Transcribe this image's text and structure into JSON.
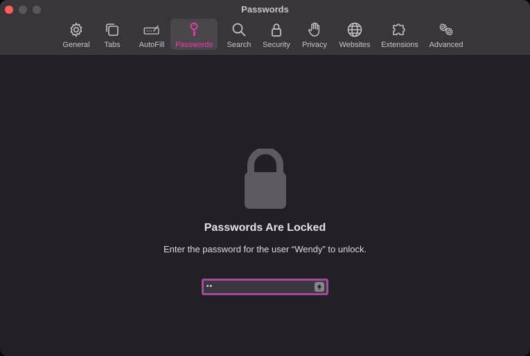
{
  "window": {
    "title": "Passwords"
  },
  "toolbar": {
    "items": [
      {
        "label": "General",
        "icon": "gear-icon",
        "active": false
      },
      {
        "label": "Tabs",
        "icon": "tabs-icon",
        "active": false
      },
      {
        "label": "AutoFill",
        "icon": "autofill-icon",
        "active": false
      },
      {
        "label": "Passwords",
        "icon": "key-icon",
        "active": true
      },
      {
        "label": "Search",
        "icon": "magnifier-icon",
        "active": false
      },
      {
        "label": "Security",
        "icon": "lock-icon",
        "active": false
      },
      {
        "label": "Privacy",
        "icon": "hand-icon",
        "active": false
      },
      {
        "label": "Websites",
        "icon": "globe-icon",
        "active": false
      },
      {
        "label": "Extensions",
        "icon": "puzzle-icon",
        "active": false
      },
      {
        "label": "Advanced",
        "icon": "gears-icon",
        "active": false
      }
    ]
  },
  "locked": {
    "title": "Passwords Are Locked",
    "message": "Enter the password for the user “Wendy” to unlock.",
    "password_value": "••"
  },
  "colors": {
    "accent": "#ee3ea8",
    "focus_ring": "#a54b9c",
    "close_button": "#ff5f57",
    "background": "#231f26",
    "toolbar_background": "#39353b"
  }
}
